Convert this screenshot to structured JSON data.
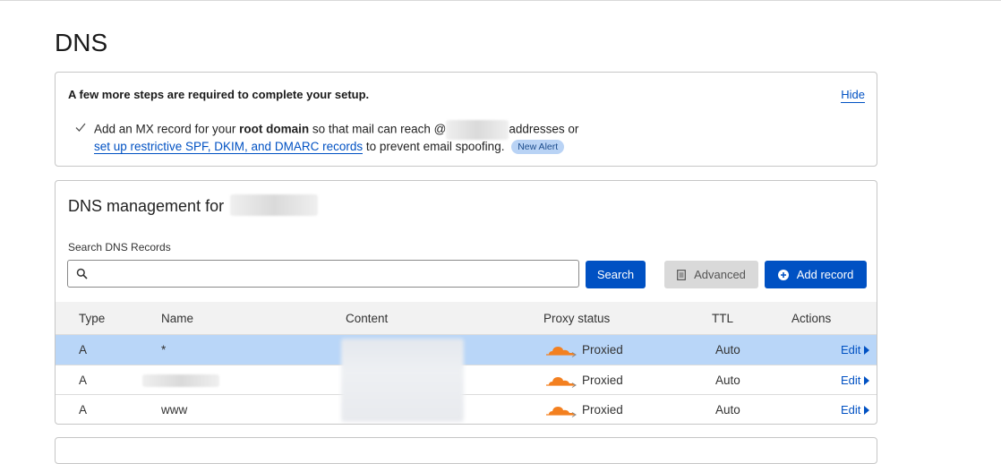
{
  "page": {
    "title": "DNS"
  },
  "setup": {
    "heading": "A few more steps are required to complete your setup.",
    "hide_label": "Hide",
    "line1_prefix": "Add an MX record for your",
    "line1_bold": "root domain",
    "line1_middle": "so that mail can reach @",
    "line1_suffix": "addresses or",
    "line2_link": "set up restrictive SPF, DKIM, and DMARC records",
    "line2_suffix": "to prevent email spoofing.",
    "badge": "New Alert"
  },
  "dns": {
    "heading_prefix": "DNS management for",
    "search_label": "Search DNS Records",
    "search_value": "",
    "search_placeholder": "",
    "search_button": "Search",
    "advanced_button": "Advanced",
    "add_record_button": "Add record",
    "columns": [
      "Type",
      "Name",
      "Content",
      "Proxy status",
      "TTL",
      "Actions"
    ],
    "rows": [
      {
        "type": "A",
        "name": "*",
        "proxy": "Proxied",
        "ttl": "Auto",
        "action": "Edit",
        "selected": true
      },
      {
        "type": "A",
        "name": "",
        "proxy": "Proxied",
        "ttl": "Auto",
        "action": "Edit",
        "selected": false
      },
      {
        "type": "A",
        "name": "www",
        "proxy": "Proxied",
        "ttl": "Auto",
        "action": "Edit",
        "selected": false
      }
    ]
  },
  "colors": {
    "accent": "#0051c3",
    "selected_row": "#b9d6f8",
    "cloud": "#f38020",
    "header_bg": "#f2f2f2"
  }
}
